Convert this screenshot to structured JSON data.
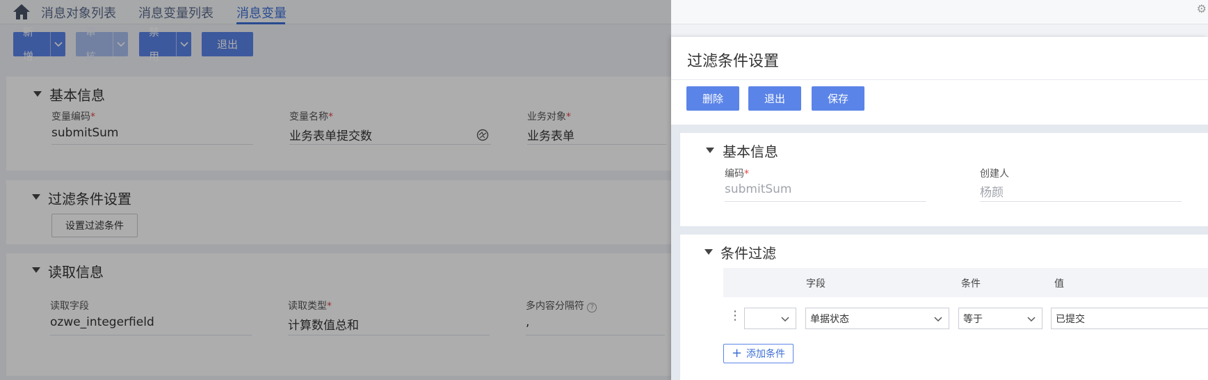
{
  "nav": {
    "tabs": [
      "消息对象列表",
      "消息变量列表",
      "消息变量"
    ],
    "active_tab": "消息变量"
  },
  "toolbar": {
    "new_label": "新增",
    "audit_label": "审核",
    "disable_label": "禁用",
    "exit_label": "退出"
  },
  "basic": {
    "title": "基本信息",
    "var_code_label": "变量编码",
    "var_code_value": "submitSum",
    "var_name_label": "变量名称",
    "var_name_value": "业务表单提交数",
    "biz_object_label": "业务对象",
    "biz_object_value": "业务表单"
  },
  "filter": {
    "title": "过滤条件设置",
    "set_button": "设置过滤条件"
  },
  "read": {
    "title": "读取信息",
    "field_label": "读取字段",
    "field_value": "ozwe_integerfield",
    "type_label": "读取类型",
    "type_value": "计算数值总和",
    "sep_label": "多内容分隔符",
    "sep_value": ","
  },
  "drawer": {
    "title": "过滤条件设置",
    "delete_label": "删除",
    "exit_label": "退出",
    "save_label": "保存",
    "basic_title": "基本信息",
    "code_label": "编码",
    "code_value": "submitSum",
    "creator_label": "创建人",
    "creator_value": "杨颜",
    "cond_title": "条件过滤",
    "columns": [
      "字段",
      "条件",
      "值"
    ],
    "row": {
      "bracket": "",
      "field": "单据状态",
      "op": "等于",
      "value": "已提交"
    },
    "add_label": "添加条件"
  },
  "colors": {
    "primary": "#5b84e8",
    "active_tab": "#3c6fd6",
    "required": "#e04444"
  }
}
